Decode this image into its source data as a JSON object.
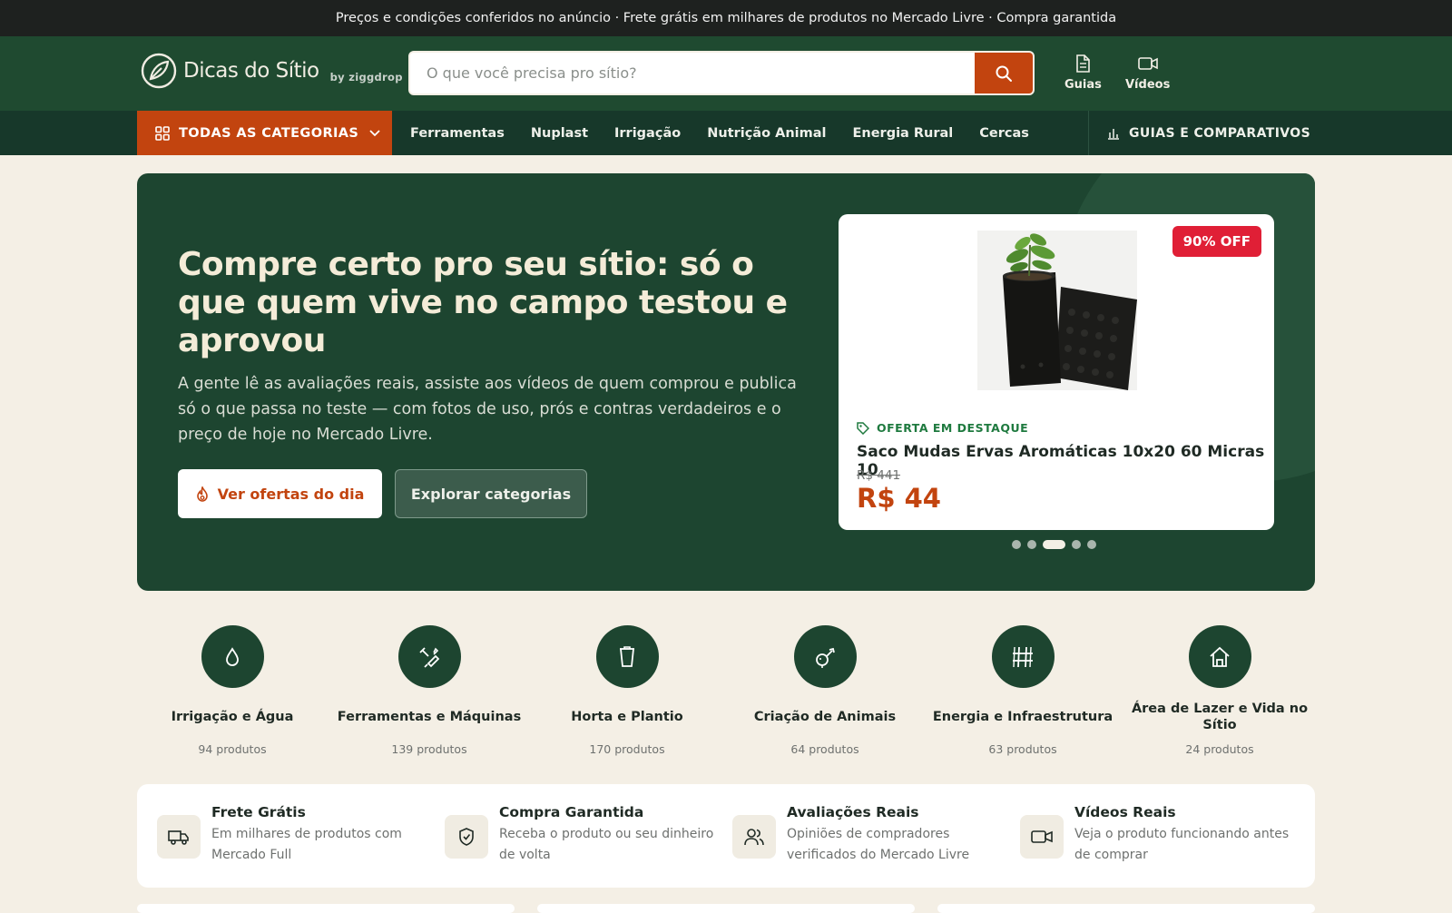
{
  "topbar": {
    "text": "Preços e condições conferidos no anúncio · Frete grátis em milhares de produtos no Mercado Livre · Compra garantida"
  },
  "header": {
    "logo_text": "Dicas do Sítio",
    "logo_by": "by ziggdrop",
    "search_placeholder": "O que você precisa pro sítio?",
    "links": [
      {
        "label": "Guias",
        "icon": "document-icon"
      },
      {
        "label": "Vídeos",
        "icon": "video-icon"
      }
    ]
  },
  "nav": {
    "all_categories": "TODAS AS CATEGORIAS",
    "items": [
      "Ferramentas",
      "Nuplast",
      "Irrigação",
      "Nutrição Animal",
      "Energia Rural",
      "Cercas"
    ],
    "guides_compare": "GUIAS E COMPARATIVOS"
  },
  "hero": {
    "title": "Compre certo pro seu sítio: só o que quem vive no campo testou e aprovou",
    "subtitle": "A gente lê as avaliações reais, assiste aos vídeos de quem comprou e publica só o que passa no teste — com fotos de uso, prós e contras verdadeiros e o preço de hoje no Mercado Livre.",
    "primary_button": "Ver ofertas do dia",
    "secondary_button": "Explorar categorias"
  },
  "offer": {
    "badge": "90% OFF",
    "tag": "OFERTA EM DESTAQUE",
    "name": "Saco Mudas Ervas Aromáticas 10x20 60 Micras 10",
    "old_price": "R$ 441",
    "new_price": "R$ 44",
    "carousel_total": 5,
    "carousel_active": 3
  },
  "categories": [
    {
      "name": "Irrigação e Água",
      "count": "94 produtos",
      "icon": "water-drop-icon"
    },
    {
      "name": "Ferramentas e Máquinas",
      "count": "139 produtos",
      "icon": "hammer-icon"
    },
    {
      "name": "Horta e Plantio",
      "count": "170 produtos",
      "icon": "pot-icon"
    },
    {
      "name": "Criação de Animais",
      "count": "64 produtos",
      "icon": "animal-icon"
    },
    {
      "name": "Energia e Infraestrutura",
      "count": "63 produtos",
      "icon": "grid-icon"
    },
    {
      "name": "Área de Lazer e Vida no Sítio",
      "count": "24 produtos",
      "icon": "home-icon"
    }
  ],
  "features": [
    {
      "title": "Frete Grátis",
      "desc": "Em milhares de produtos com Mercado Full",
      "icon": "truck-icon"
    },
    {
      "title": "Compra Garantida",
      "desc": "Receba o produto ou seu dinheiro de volta",
      "icon": "shield-icon"
    },
    {
      "title": "Avaliações Reais",
      "desc": "Opiniões de compradores verificados do Mercado Livre",
      "icon": "users-icon"
    },
    {
      "title": "Vídeos Reais",
      "desc": "Veja o produto funcionando antes de comprar",
      "icon": "video-icon"
    }
  ],
  "colors": {
    "primary_green": "#1d4530",
    "accent_orange": "#c2440f",
    "badge_red": "#e01f36",
    "background": "#f4efe5"
  }
}
